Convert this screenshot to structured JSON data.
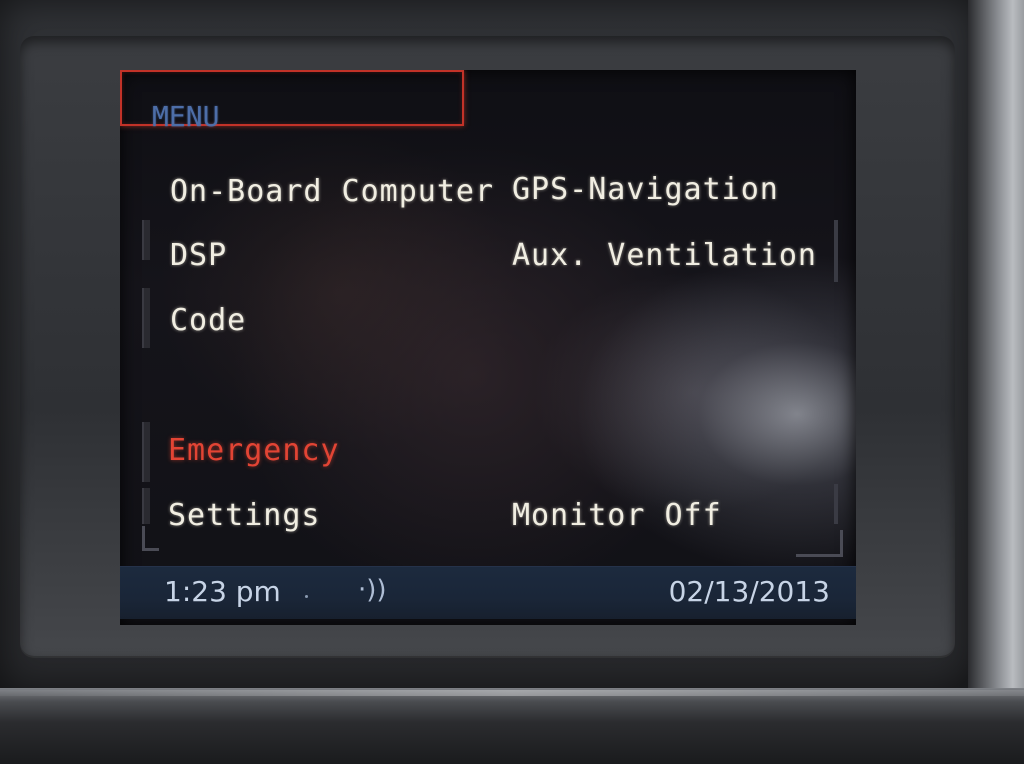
{
  "menu": {
    "title": "MENU",
    "items": [
      {
        "label": "On-Board Computer",
        "selected": true
      },
      {
        "label": "GPS-Navigation"
      },
      {
        "label": "DSP"
      },
      {
        "label": "Aux. Ventilation"
      },
      {
        "label": "Code"
      },
      {
        "label": "Emergency",
        "color": "#e24434"
      },
      {
        "label": "Settings"
      },
      {
        "label": "Monitor Off"
      }
    ]
  },
  "status_bar": {
    "time": "1:23 pm",
    "sound_icon": "speaker-waves-icon",
    "date": "02/13/2013"
  },
  "colors": {
    "title": "#4d6ea8",
    "text": "#f1eee2",
    "selection_border": "#c23228",
    "emergency": "#e24434",
    "status_bar": "#1c2a3e"
  }
}
